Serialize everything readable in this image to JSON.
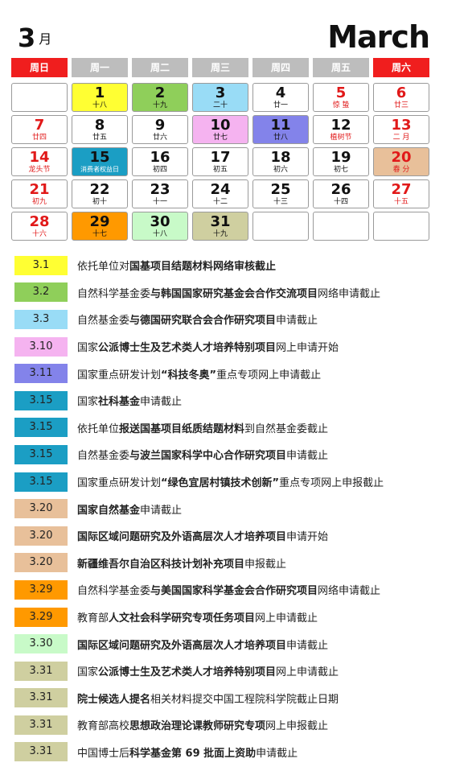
{
  "title": {
    "month_num": "3",
    "month_cn": "月",
    "month_en": "March"
  },
  "weekdays": [
    "周日",
    "周一",
    "周二",
    "周三",
    "周四",
    "周五",
    "周六"
  ],
  "colors": {
    "weekend_header": "#f01e1e",
    "weekday_header": "#bdbdbd",
    "yellow": "#ffff33",
    "green": "#8fcf5a",
    "lightblue": "#99dcf6",
    "pink": "#f5b3f0",
    "periwinkle": "#8383ea",
    "teal": "#1b9ec4",
    "tan": "#e8c09a",
    "orange": "#ff9900",
    "mint": "#c8fac8",
    "khaki": "#cfcfa0"
  },
  "calendar": [
    [
      null,
      {
        "d": "1",
        "l": "十八",
        "c": "#ffff33"
      },
      {
        "d": "2",
        "l": "十九",
        "c": "#8fcf5a"
      },
      {
        "d": "3",
        "l": "二十",
        "c": "#99dcf6"
      },
      {
        "d": "4",
        "l": "廿一"
      },
      {
        "d": "5",
        "l": "惊 蛰",
        "red": true
      },
      {
        "d": "6",
        "l": "廿三",
        "red": true
      }
    ],
    [
      {
        "d": "7",
        "l": "廿四",
        "red": true
      },
      {
        "d": "8",
        "l": "廿五"
      },
      {
        "d": "9",
        "l": "廿六"
      },
      {
        "d": "10",
        "l": "廿七",
        "c": "#f5b3f0"
      },
      {
        "d": "11",
        "l": "廿八",
        "c": "#8383ea"
      },
      {
        "d": "12",
        "l": "植树节",
        "lred": true
      },
      {
        "d": "13",
        "l": "二 月",
        "red": true
      }
    ],
    [
      {
        "d": "14",
        "l": "龙头节",
        "red": true
      },
      {
        "d": "15",
        "l": "消费者权益日",
        "c": "#1b9ec4",
        "white": true
      },
      {
        "d": "16",
        "l": "初四"
      },
      {
        "d": "17",
        "l": "初五"
      },
      {
        "d": "18",
        "l": "初六"
      },
      {
        "d": "19",
        "l": "初七"
      },
      {
        "d": "20",
        "l": "春 分",
        "c": "#e8c09a",
        "red": true
      }
    ],
    [
      {
        "d": "21",
        "l": "初九",
        "red": true
      },
      {
        "d": "22",
        "l": "初十"
      },
      {
        "d": "23",
        "l": "十一"
      },
      {
        "d": "24",
        "l": "十二"
      },
      {
        "d": "25",
        "l": "十三"
      },
      {
        "d": "26",
        "l": "十四"
      },
      {
        "d": "27",
        "l": "十五",
        "red": true
      }
    ],
    [
      {
        "d": "28",
        "l": "十六",
        "red": true
      },
      {
        "d": "29",
        "l": "十七",
        "c": "#ff9900"
      },
      {
        "d": "30",
        "l": "十八",
        "c": "#c8fac8"
      },
      {
        "d": "31",
        "l": "十九",
        "c": "#cfcfa0"
      },
      null,
      null,
      null
    ]
  ],
  "events": [
    {
      "date": "3.1",
      "color": "#ffff33",
      "parts": [
        [
          "依托单位对",
          false
        ],
        [
          "国基项目结题材料网络审核截止",
          true
        ]
      ]
    },
    {
      "date": "3.2",
      "color": "#8fcf5a",
      "parts": [
        [
          "自然科学基金委",
          false
        ],
        [
          "与韩国国家研究基金会合作交流项目",
          true
        ],
        [
          "网络申请截止",
          false
        ]
      ]
    },
    {
      "date": "3.3",
      "color": "#99dcf6",
      "parts": [
        [
          "自然基金委",
          false
        ],
        [
          "与德国研究联合会合作研究项目",
          true
        ],
        [
          "申请截止",
          false
        ]
      ]
    },
    {
      "date": "3.10",
      "color": "#f5b3f0",
      "parts": [
        [
          "国家",
          false
        ],
        [
          "公派博士生及艺术类人才培养特别项目",
          true
        ],
        [
          "网上申请开始",
          false
        ]
      ]
    },
    {
      "date": "3.11",
      "color": "#8383ea",
      "parts": [
        [
          "国家重点研发计划",
          false
        ],
        [
          "“科技冬奥”",
          true
        ],
        [
          "重点专项网上申请截止",
          false
        ]
      ]
    },
    {
      "date": "3.15",
      "color": "#1b9ec4",
      "parts": [
        [
          "国家",
          false
        ],
        [
          "社科基金",
          true
        ],
        [
          "申请截止",
          false
        ]
      ]
    },
    {
      "date": "3.15",
      "color": "#1b9ec4",
      "parts": [
        [
          "依托单位",
          false
        ],
        [
          "报送国基项目纸质结题材料",
          true
        ],
        [
          "到自然基金委截止",
          false
        ]
      ]
    },
    {
      "date": "3.15",
      "color": "#1b9ec4",
      "parts": [
        [
          "自然基金委",
          false
        ],
        [
          "与波兰国家科学中心合作研究项目",
          true
        ],
        [
          "申请截止",
          false
        ]
      ]
    },
    {
      "date": "3.15",
      "color": "#1b9ec4",
      "parts": [
        [
          "国家重点研发计划",
          false
        ],
        [
          "“绿色宜居村镇技术创新”",
          true
        ],
        [
          "重点专项网上申报截止",
          false
        ]
      ]
    },
    {
      "date": "3.20",
      "color": "#e8c09a",
      "parts": [
        [
          "国家自然基金",
          true
        ],
        [
          "申请截止",
          false
        ]
      ]
    },
    {
      "date": "3.20",
      "color": "#e8c09a",
      "parts": [
        [
          "国际区域问题研究及外语高层次人才培养项目",
          true
        ],
        [
          "申请开始",
          false
        ]
      ]
    },
    {
      "date": "3.20",
      "color": "#e8c09a",
      "parts": [
        [
          "新疆维吾尔自治区科技计划补充项目",
          true
        ],
        [
          "申报截止",
          false
        ]
      ]
    },
    {
      "date": "3.29",
      "color": "#ff9900",
      "parts": [
        [
          "自然科学基金委",
          false
        ],
        [
          "与美国国家科学基金会合作研究项目",
          true
        ],
        [
          "网络申请截止",
          false
        ]
      ]
    },
    {
      "date": "3.29",
      "color": "#ff9900",
      "parts": [
        [
          "教育部",
          false
        ],
        [
          "人文社会科学研究专项任务项目",
          true
        ],
        [
          "网上申请截止",
          false
        ]
      ]
    },
    {
      "date": "3.30",
      "color": "#c8fac8",
      "parts": [
        [
          "国际区域问题研究及外语高层次人才培养项目",
          true
        ],
        [
          "申请截止",
          false
        ]
      ]
    },
    {
      "date": "3.31",
      "color": "#cfcfa0",
      "parts": [
        [
          "国家",
          false
        ],
        [
          "公派博士生及艺术类人才培养特别项目",
          true
        ],
        [
          "网上申请截止",
          false
        ]
      ]
    },
    {
      "date": "3.31",
      "color": "#cfcfa0",
      "parts": [
        [
          "院士候选人提名",
          true
        ],
        [
          "相关材料提交中国工程院科学院截止日期",
          false
        ]
      ]
    },
    {
      "date": "3.31",
      "color": "#cfcfa0",
      "parts": [
        [
          "教育部高校",
          false
        ],
        [
          "思想政治理论课教师研究专项",
          true
        ],
        [
          "网上申报截止",
          false
        ]
      ]
    },
    {
      "date": "3.31",
      "color": "#cfcfa0",
      "parts": [
        [
          "中国博士后",
          false
        ],
        [
          "科学基金第 69 批面上资助",
          true
        ],
        [
          "申请截止",
          false
        ]
      ]
    }
  ]
}
